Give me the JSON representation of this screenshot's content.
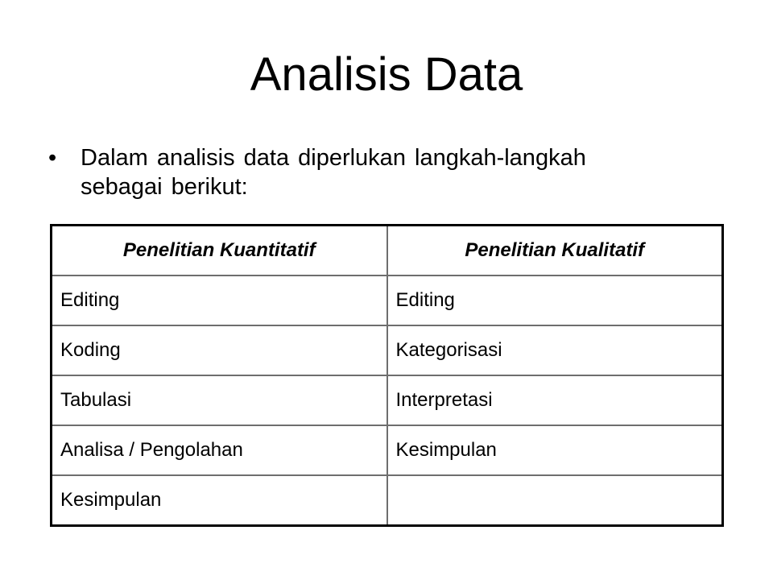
{
  "slide": {
    "title": "Analisis Data",
    "bullets": [
      {
        "glyph": "•",
        "text": "Dalam analisis data diperlukan langkah-langkah sebagai berikut:"
      }
    ]
  },
  "table": {
    "headers": [
      "Penelitian Kuantitatif",
      "Penelitian Kualitatif"
    ],
    "rows": [
      [
        "Editing",
        "Editing"
      ],
      [
        "Koding",
        "Kategorisasi"
      ],
      [
        "Tabulasi",
        "Interpretasi"
      ],
      [
        "Analisa / Pengolahan",
        "Kesimpulan"
      ],
      [
        "Kesimpulan",
        ""
      ]
    ]
  }
}
